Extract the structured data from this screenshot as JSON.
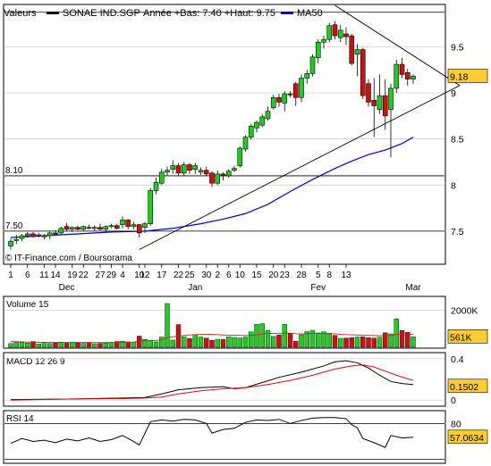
{
  "header": {
    "valeurs_label": "Valeurs",
    "series_name": "SONAE IND.SGP",
    "annee_text": "Année +Bas: 7.40 +Haut: 9.75",
    "ma_label": "MA50"
  },
  "colors": {
    "up": "#22cc22",
    "down": "#cc1111",
    "ma50": "#0000cc",
    "badge": "#ffcc33",
    "trendline": "#000000",
    "grid": "#c8c8c8"
  },
  "footer": {
    "credit": "© IT-Finance.com / Boursorama"
  },
  "chart_data": [
    {
      "type": "candlestick",
      "title": "SONAE IND.SGP",
      "x_ticks": [
        "1",
        "6",
        "11",
        "14",
        "19",
        "22",
        "27",
        "29",
        "4",
        "10",
        "12",
        "17",
        "22",
        "25",
        "30",
        "2",
        "6",
        "10",
        "15",
        "20",
        "23",
        "28",
        "5",
        "8",
        "13"
      ],
      "months": [
        "Dec",
        "Jan",
        "Fev",
        "Mar"
      ],
      "ylim": [
        7.15,
        9.95
      ],
      "y_ticks": [
        7.5,
        8,
        8.5,
        9,
        9.5
      ],
      "last_value": "9.18",
      "ref_lines": [
        {
          "label": "8.10",
          "value": 8.1
        },
        {
          "label": "7.50",
          "value": 7.5
        }
      ],
      "trendlines": [
        {
          "from": {
            "idx": 23,
            "v": 7.3
          },
          "to": {
            "idx": 80,
            "v": 9.08
          }
        },
        {
          "from": {
            "idx": 58,
            "v": 9.95
          },
          "to": {
            "idx": 80,
            "v": 9.08
          }
        }
      ],
      "candles": [
        [
          7.34,
          7.42,
          7.3,
          7.39
        ],
        [
          7.4,
          7.46,
          7.36,
          7.41
        ],
        [
          7.42,
          7.47,
          7.39,
          7.45
        ],
        [
          7.45,
          7.49,
          7.43,
          7.47
        ],
        [
          7.47,
          7.49,
          7.43,
          7.44
        ],
        [
          7.45,
          7.48,
          7.43,
          7.46
        ],
        [
          7.44,
          7.47,
          7.41,
          7.45
        ],
        [
          7.45,
          7.5,
          7.41,
          7.48
        ],
        [
          7.48,
          7.51,
          7.45,
          7.47
        ],
        [
          7.48,
          7.55,
          7.46,
          7.53
        ],
        [
          7.55,
          7.59,
          7.5,
          7.52
        ],
        [
          7.52,
          7.55,
          7.49,
          7.54
        ],
        [
          7.54,
          7.56,
          7.51,
          7.52
        ],
        [
          7.52,
          7.56,
          7.5,
          7.55
        ],
        [
          7.54,
          7.57,
          7.52,
          7.53
        ],
        [
          7.53,
          7.56,
          7.5,
          7.54
        ],
        [
          7.54,
          7.58,
          7.51,
          7.52
        ],
        [
          7.52,
          7.56,
          7.49,
          7.55
        ],
        [
          7.55,
          7.58,
          7.53,
          7.56
        ],
        [
          7.56,
          7.58,
          7.52,
          7.53
        ],
        [
          7.57,
          7.66,
          7.53,
          7.62
        ],
        [
          7.62,
          7.63,
          7.52,
          7.55
        ],
        [
          7.55,
          7.6,
          7.52,
          7.57
        ],
        [
          7.57,
          7.58,
          7.43,
          7.48
        ],
        [
          7.54,
          7.6,
          7.48,
          7.58
        ],
        [
          7.58,
          7.97,
          7.56,
          7.94
        ],
        [
          7.94,
          8.08,
          7.9,
          8.03
        ],
        [
          8.02,
          8.18,
          8.0,
          8.14
        ],
        [
          8.14,
          8.2,
          8.1,
          8.16
        ],
        [
          8.17,
          8.27,
          8.12,
          8.21
        ],
        [
          8.21,
          8.24,
          8.1,
          8.13
        ],
        [
          8.13,
          8.25,
          8.1,
          8.22
        ],
        [
          8.22,
          8.24,
          8.12,
          8.16
        ],
        [
          8.17,
          8.24,
          8.12,
          8.21
        ],
        [
          8.14,
          8.19,
          8.11,
          8.16
        ],
        [
          8.16,
          8.2,
          8.1,
          8.12
        ],
        [
          8.13,
          8.15,
          7.98,
          8.02
        ],
        [
          8.02,
          8.16,
          8.0,
          8.12
        ],
        [
          8.12,
          8.14,
          8.05,
          8.1
        ],
        [
          8.1,
          8.17,
          8.08,
          8.15
        ],
        [
          8.16,
          8.21,
          8.14,
          8.18
        ],
        [
          8.21,
          8.42,
          8.19,
          8.4
        ],
        [
          8.39,
          8.54,
          8.36,
          8.52
        ],
        [
          8.52,
          8.66,
          8.49,
          8.64
        ],
        [
          8.62,
          8.7,
          8.57,
          8.68
        ],
        [
          8.65,
          8.77,
          8.63,
          8.74
        ],
        [
          8.72,
          8.85,
          8.7,
          8.8
        ],
        [
          8.84,
          8.98,
          8.82,
          8.95
        ],
        [
          8.95,
          8.99,
          8.85,
          8.9
        ],
        [
          8.89,
          9.02,
          8.8,
          8.99
        ],
        [
          8.99,
          9.02,
          8.95,
          8.98
        ],
        [
          9.1,
          9.12,
          8.86,
          8.95
        ],
        [
          8.95,
          9.2,
          8.9,
          9.16
        ],
        [
          9.16,
          9.25,
          9.1,
          9.21
        ],
        [
          9.21,
          9.42,
          9.18,
          9.39
        ],
        [
          9.38,
          9.58,
          9.32,
          9.55
        ],
        [
          9.55,
          9.62,
          9.48,
          9.58
        ],
        [
          9.58,
          9.76,
          9.55,
          9.73
        ],
        [
          9.74,
          9.78,
          9.58,
          9.62
        ],
        [
          9.6,
          9.74,
          9.55,
          9.68
        ],
        [
          9.64,
          9.71,
          9.52,
          9.61
        ],
        [
          9.62,
          9.64,
          9.3,
          9.32
        ],
        [
          9.42,
          9.53,
          9.18,
          9.47
        ],
        [
          9.47,
          9.49,
          8.93,
          8.97
        ],
        [
          9.1,
          9.15,
          8.85,
          8.9
        ],
        [
          8.92,
          9.16,
          8.52,
          8.86
        ],
        [
          8.82,
          9.2,
          8.77,
          8.97
        ],
        [
          8.97,
          9.15,
          8.6,
          8.75
        ],
        [
          8.82,
          9.1,
          8.3,
          9.05
        ],
        [
          9.05,
          9.36,
          9.0,
          9.31
        ],
        [
          9.31,
          9.38,
          9.16,
          9.2
        ],
        [
          9.22,
          9.26,
          9.08,
          9.15
        ],
        [
          9.15,
          9.2,
          9.1,
          9.18
        ]
      ],
      "ma50": [
        [
          0,
          7.43
        ],
        [
          6,
          7.45
        ],
        [
          12,
          7.47
        ],
        [
          18,
          7.49
        ],
        [
          24,
          7.5
        ],
        [
          29,
          7.53
        ],
        [
          34,
          7.58
        ],
        [
          38,
          7.63
        ],
        [
          42,
          7.69
        ],
        [
          46,
          7.79
        ],
        [
          50,
          7.93
        ],
        [
          54,
          8.06
        ],
        [
          58,
          8.18
        ],
        [
          61,
          8.26
        ],
        [
          64,
          8.33
        ],
        [
          67,
          8.38
        ],
        [
          70,
          8.45
        ],
        [
          72,
          8.52
        ]
      ]
    },
    {
      "type": "bar",
      "title": "Volume 15",
      "y_ticks": [
        {
          "label": "2000K",
          "value": 2000
        }
      ],
      "last_value": "561K",
      "ylim": [
        0,
        2350
      ],
      "values": [
        200,
        280,
        250,
        230,
        310,
        180,
        260,
        200,
        240,
        280,
        220,
        260,
        240,
        210,
        250,
        190,
        200,
        230,
        260,
        310,
        330,
        290,
        270,
        600,
        420,
        380,
        290,
        550,
        2350,
        390,
        1220,
        570,
        470,
        680,
        550,
        490,
        370,
        430,
        420,
        560,
        530,
        500,
        550,
        830,
        1230,
        1270,
        910,
        580,
        660,
        1240,
        740,
        330,
        670,
        840,
        910,
        770,
        830,
        750,
        640,
        480,
        490,
        520,
        550,
        560,
        520,
        490,
        540,
        780,
        720,
        1520,
        900,
        800,
        561
      ],
      "ma": [
        300,
        300,
        290,
        280,
        275,
        270,
        268,
        265,
        262,
        260,
        262,
        265,
        262,
        260,
        258,
        255,
        252,
        254,
        258,
        262,
        270,
        275,
        278,
        330,
        350,
        360,
        370,
        395,
        520,
        560,
        610,
        640,
        660,
        680,
        700,
        700,
        690,
        680,
        660,
        650,
        650,
        640,
        630,
        640,
        670,
        720,
        740,
        740,
        740,
        760,
        760,
        730,
        720,
        730,
        740,
        740,
        740,
        730,
        720,
        700,
        680,
        670,
        660,
        650,
        640,
        630,
        620,
        630,
        640,
        690,
        700,
        710,
        690
      ]
    },
    {
      "type": "line",
      "title": "MACD 12 26 9",
      "ylim": [
        -0.05,
        0.45
      ],
      "y_ticks": [
        {
          "label": "0.4",
          "value": 0.4
        },
        {
          "label": "0",
          "value": 0
        }
      ],
      "last_value": "0.1502",
      "macd": [
        [
          0,
          0.005
        ],
        [
          10,
          0.01
        ],
        [
          20,
          0.02
        ],
        [
          24,
          0.025
        ],
        [
          27,
          0.06
        ],
        [
          30,
          0.1
        ],
        [
          34,
          0.12
        ],
        [
          38,
          0.13
        ],
        [
          40,
          0.11
        ],
        [
          42,
          0.12
        ],
        [
          45,
          0.17
        ],
        [
          48,
          0.22
        ],
        [
          52,
          0.27
        ],
        [
          56,
          0.33
        ],
        [
          58,
          0.37
        ],
        [
          60,
          0.38
        ],
        [
          62,
          0.36
        ],
        [
          64,
          0.31
        ],
        [
          66,
          0.24
        ],
        [
          68,
          0.18
        ],
        [
          70,
          0.16
        ],
        [
          72,
          0.15
        ]
      ],
      "signal": [
        [
          0,
          0.0
        ],
        [
          10,
          0.01
        ],
        [
          20,
          0.015
        ],
        [
          24,
          0.02
        ],
        [
          27,
          0.03
        ],
        [
          30,
          0.06
        ],
        [
          34,
          0.09
        ],
        [
          38,
          0.11
        ],
        [
          42,
          0.12
        ],
        [
          46,
          0.15
        ],
        [
          50,
          0.19
        ],
        [
          54,
          0.24
        ],
        [
          58,
          0.3
        ],
        [
          61,
          0.33
        ],
        [
          63,
          0.34
        ],
        [
          65,
          0.32
        ],
        [
          67,
          0.28
        ],
        [
          69,
          0.24
        ],
        [
          72,
          0.19
        ]
      ]
    },
    {
      "type": "line",
      "title": "RSI 14",
      "ylim": [
        15,
        100
      ],
      "y_ticks": [
        {
          "label": "80",
          "value": 80
        }
      ],
      "ref_lines": [
        80,
        20
      ],
      "last_value": "57.0634",
      "values": [
        [
          0,
          47
        ],
        [
          2,
          55
        ],
        [
          4,
          50
        ],
        [
          6,
          52
        ],
        [
          8,
          48
        ],
        [
          10,
          54
        ],
        [
          12,
          51
        ],
        [
          14,
          56
        ],
        [
          16,
          50
        ],
        [
          18,
          53
        ],
        [
          20,
          60
        ],
        [
          22,
          50
        ],
        [
          23,
          44
        ],
        [
          25,
          83
        ],
        [
          27,
          86
        ],
        [
          29,
          84
        ],
        [
          31,
          87
        ],
        [
          33,
          86
        ],
        [
          35,
          80
        ],
        [
          36,
          64
        ],
        [
          38,
          70
        ],
        [
          40,
          72
        ],
        [
          42,
          82
        ],
        [
          44,
          86
        ],
        [
          46,
          85
        ],
        [
          48,
          87
        ],
        [
          50,
          80
        ],
        [
          52,
          85
        ],
        [
          54,
          89
        ],
        [
          56,
          90
        ],
        [
          58,
          90
        ],
        [
          60,
          88
        ],
        [
          61,
          78
        ],
        [
          62,
          73
        ],
        [
          63,
          55
        ],
        [
          65,
          48
        ],
        [
          67,
          40
        ],
        [
          68,
          60
        ],
        [
          70,
          56
        ],
        [
          72,
          57
        ]
      ]
    }
  ]
}
